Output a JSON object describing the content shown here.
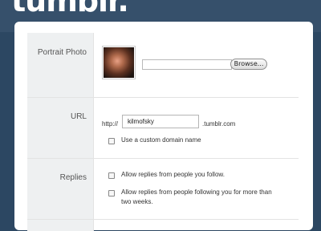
{
  "app": {
    "logo_text": "tumblr."
  },
  "portrait": {
    "label": "Portrait Photo",
    "browse_label": "Browse..."
  },
  "url": {
    "label": "URL",
    "prefix": "http://",
    "value": "kilmofsky",
    "suffix": ".tumblr.com",
    "custom_domain_label": "Use a custom domain name"
  },
  "replies": {
    "label": "Replies",
    "option1": "Allow replies from people you follow.",
    "option2_line1": "Allow replies from people following you for more than",
    "option2_line2": "two weeks."
  }
}
